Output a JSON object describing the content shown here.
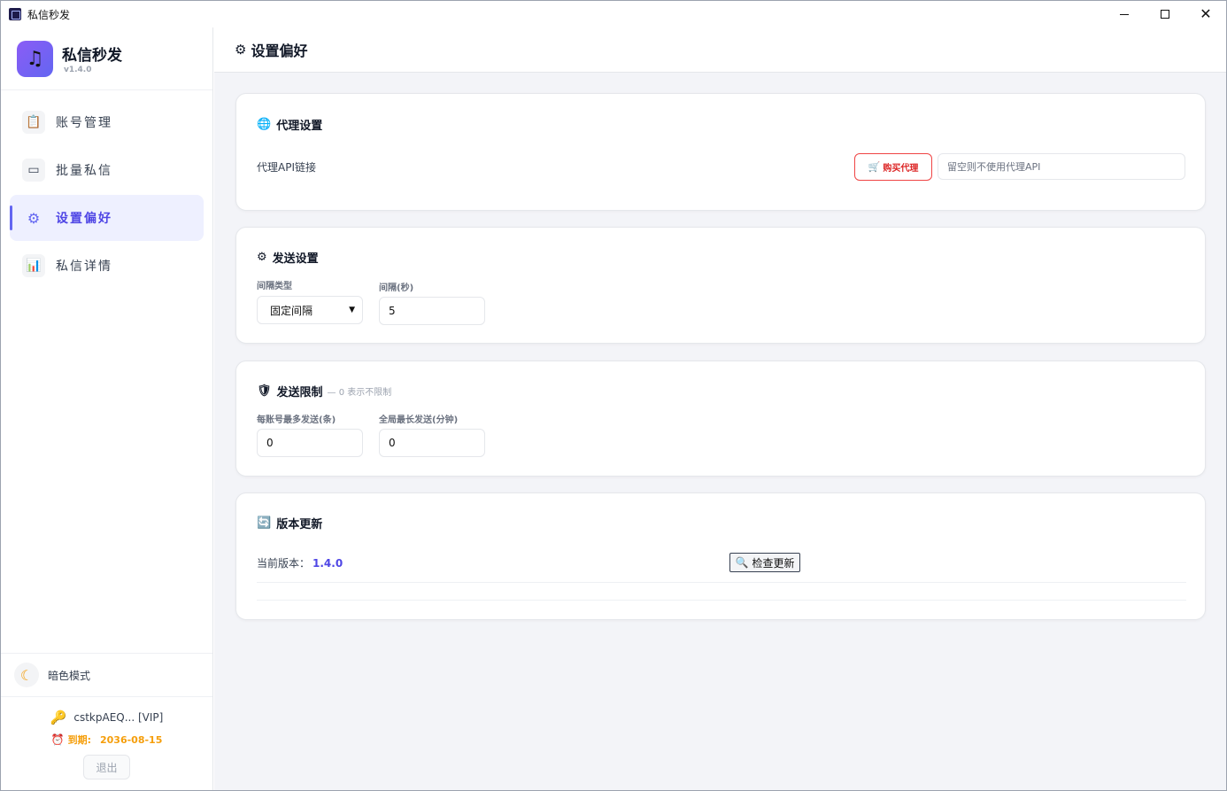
{
  "window": {
    "title": "私信秒发"
  },
  "brand": {
    "name": "私信秒发",
    "version": "v1.4.0"
  },
  "nav": {
    "items": [
      {
        "label": "账号管理",
        "icon": "clipboard-icon"
      },
      {
        "label": "批量私信",
        "icon": "envelope-icon"
      },
      {
        "label": "设置偏好",
        "icon": "gear-icon",
        "active": true
      },
      {
        "label": "私信详情",
        "icon": "bar-chart-icon"
      }
    ]
  },
  "sidebar_bottom": {
    "dark_mode_label": "暗色模式",
    "user": "cstkpAEQ... [VIP]",
    "expire_label": "到期:",
    "expire_date": "2036-08-15",
    "logout_label": "退出"
  },
  "header": {
    "title": "设置偏好"
  },
  "proxy": {
    "title": "代理设置",
    "api_label": "代理API链接",
    "buy_label": "购买代理",
    "input_placeholder": "留空则不使用代理API",
    "input_value": ""
  },
  "send": {
    "title": "发送设置",
    "interval_type_label": "间隔类型",
    "interval_type_value": "固定间隔",
    "interval_label": "间隔(秒)",
    "interval_value": "5"
  },
  "limit": {
    "title": "发送限制",
    "note": "— 0 表示不限制",
    "per_account_label": "每账号最多发送(条)",
    "per_account_value": "0",
    "global_label": "全局最长发送(分钟)",
    "global_value": "0"
  },
  "update": {
    "title": "版本更新",
    "current_label": "当前版本：",
    "current_version": "1.4.0",
    "check_label": "检查更新"
  },
  "colors": {
    "accent": "#6366f1",
    "danger": "#dc2626",
    "warning": "#f59e0b",
    "background": "#f3f4f8"
  }
}
